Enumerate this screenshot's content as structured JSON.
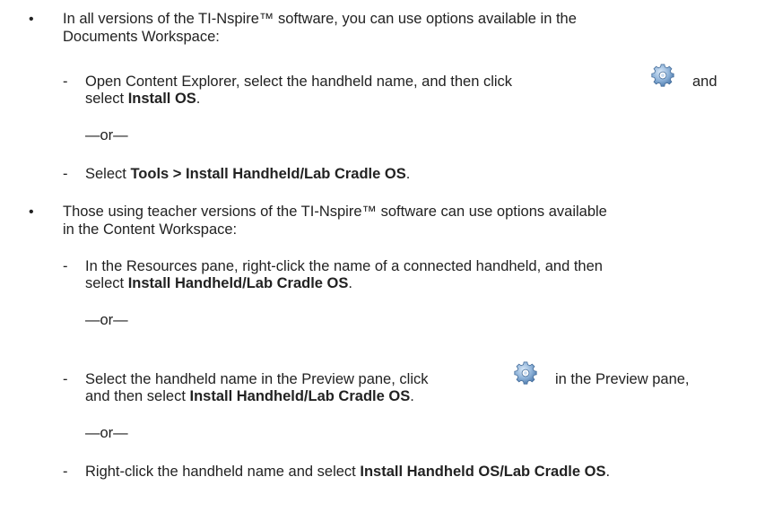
{
  "bullets": [
    {
      "marker": "•",
      "line1": "In all versions of the TI-Nspire™ software, you can use options available in the",
      "line2": "Documents Workspace:",
      "items": [
        {
          "marker": "-",
          "part1": "Open Content Explorer, select the handheld name, and then click",
          "part2": "and",
          "line2_plain": "select ",
          "line2_bold": "Install OS",
          "line2_end": ".",
          "icon": "gear-icon"
        },
        {
          "separator": "—or—"
        },
        {
          "marker": "-",
          "plain": "Select ",
          "bold": "Tools > Install Handheld/Lab Cradle OS",
          "end": "."
        }
      ]
    },
    {
      "marker": "•",
      "line1": "Those using teacher versions of the TI-Nspire™ software can use options available",
      "line2": "in the Content Workspace:",
      "items": [
        {
          "marker": "-",
          "line1": "In the Resources pane, right-click the name of a connected handheld, and then",
          "line2_plain": "select ",
          "line2_bold": "Install Handheld/Lab Cradle OS",
          "line2_end": "."
        },
        {
          "separator": "—or—"
        },
        {
          "marker": "-",
          "part1": "Select the handheld name in the Preview pane, click",
          "part2": "in the Preview pane,",
          "line2_plain": "and then select ",
          "line2_bold": "Install Handheld/Lab Cradle OS",
          "line2_end": ".",
          "icon": "gear-icon"
        },
        {
          "separator": "—or—"
        },
        {
          "marker": "-",
          "plain": "Right-click the handheld name and select ",
          "bold": "Install Handheld OS/Lab Cradle OS",
          "end": "."
        }
      ]
    }
  ]
}
